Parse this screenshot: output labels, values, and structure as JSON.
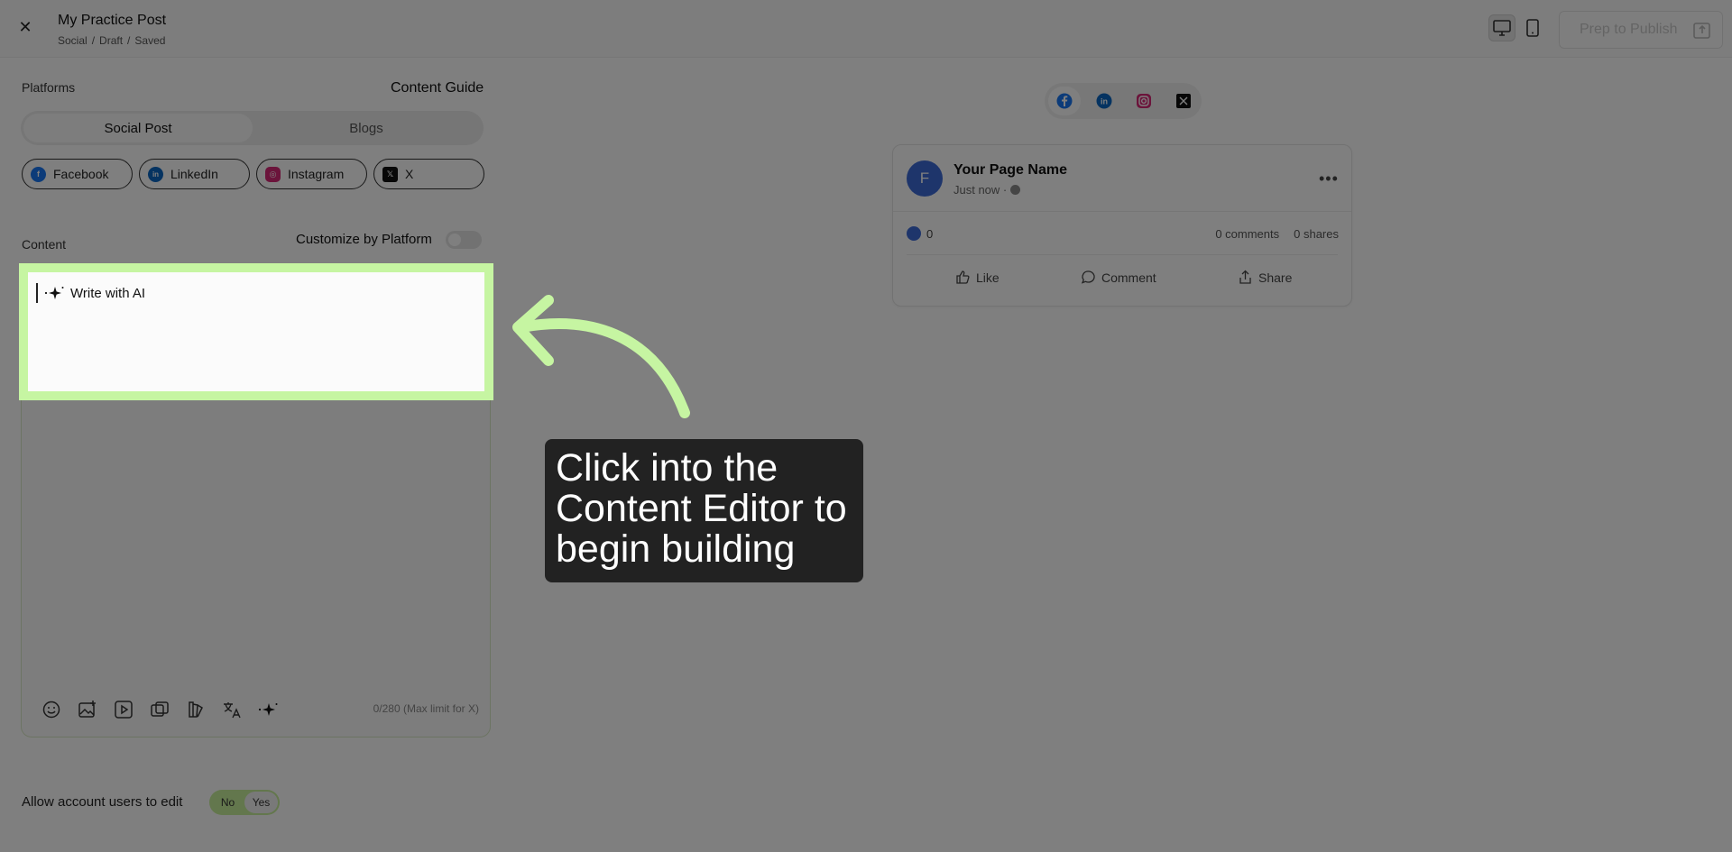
{
  "header": {
    "close_icon": "close-icon",
    "title": "My Practice Post",
    "breadcrumb": [
      "Social",
      "/",
      "Draft",
      "/",
      "Saved"
    ],
    "publish_label": "Prep to Publish"
  },
  "left": {
    "platforms_label": "Platforms",
    "content_guide": "Content Guide",
    "post_types": [
      "Social Post",
      "Blogs"
    ],
    "platforms": [
      {
        "name": "Facebook",
        "color": "#1877f2"
      },
      {
        "name": "LinkedIn",
        "color": "#0a66c2"
      },
      {
        "name": "Instagram",
        "color": "#d62976"
      },
      {
        "name": "X",
        "color": "#111111"
      }
    ],
    "content_label": "Content",
    "customize_label": "Customize by Platform",
    "write_ai": "Write with AI",
    "char_count": "0/280 (Max limit for X)",
    "allow_label": "Allow account users to edit",
    "allow_options": [
      "No",
      "Yes"
    ],
    "allow_selected": "Yes"
  },
  "preview": {
    "page_name": "Your Page Name",
    "avatar_letter": "F",
    "time": "Just now ·",
    "likes": "0",
    "comments": "0 comments",
    "shares": "0 shares",
    "actions": [
      "Like",
      "Comment",
      "Share"
    ]
  },
  "tour": {
    "tooltip": "Click into the Content Editor to begin building",
    "highlight_color": "#c6f5a2",
    "overlay_color": "#000000"
  }
}
